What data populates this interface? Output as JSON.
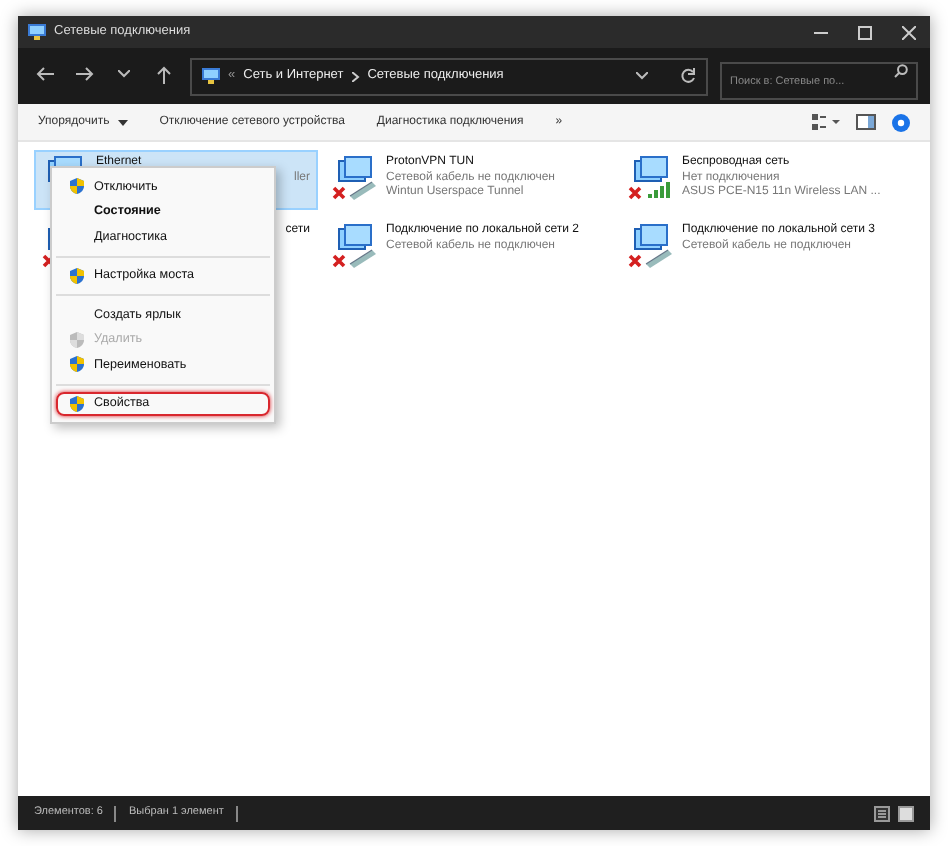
{
  "window": {
    "title": "Сетевые подключения"
  },
  "address": {
    "prefix": "«",
    "crumbs": [
      "Сеть и Интернет",
      "Сетевые подключения"
    ]
  },
  "search": {
    "placeholder": "Поиск в: Сетевые по..."
  },
  "toolbar": {
    "items": [
      {
        "label": "Упорядочить",
        "dropdown": true
      },
      {
        "label": "Отключение сетевого устройства",
        "dropdown": false
      },
      {
        "label": "Диагностика подключения",
        "dropdown": false
      },
      {
        "label": "»",
        "dropdown": false
      }
    ]
  },
  "connections": [
    {
      "name": "Ethernet",
      "device": "ller",
      "kind": "cable",
      "disconnected": false,
      "selected": true,
      "cut": true
    },
    {
      "name": "ProtonVPN TUN",
      "status": "Сетевой кабель не подключен",
      "device": "Wintun Userspace Tunnel",
      "kind": "cable",
      "disconnected": true,
      "selected": false,
      "cut": false
    },
    {
      "name": "Беспроводная сеть",
      "status": "Нет подключения",
      "device": "ASUS PCE-N15 11n Wireless LAN ...",
      "kind": "wireless",
      "disconnected": true,
      "selected": false,
      "cut": false
    },
    {
      "name": "сети",
      "kind": "cable",
      "disconnected": true,
      "selected": false,
      "cut": true
    },
    {
      "name": "Подключение по локальной сети 2",
      "status": "Сетевой кабель не подключен",
      "kind": "cable",
      "disconnected": true,
      "selected": false,
      "cut": false
    },
    {
      "name": "Подключение по локальной сети 3",
      "status": "Сетевой кабель не подключен",
      "kind": "cable",
      "disconnected": true,
      "selected": false,
      "cut": false
    }
  ],
  "context_menu": {
    "items": [
      {
        "kind": "item",
        "label": "Отключить",
        "shield": true,
        "bold": false,
        "disabled": false,
        "highlighted": false
      },
      {
        "kind": "item",
        "label": "Состояние",
        "shield": false,
        "bold": true,
        "disabled": false,
        "highlighted": false
      },
      {
        "kind": "item",
        "label": "Диагностика",
        "shield": false,
        "bold": false,
        "disabled": false,
        "highlighted": false
      },
      {
        "kind": "separator"
      },
      {
        "kind": "item",
        "label": "Настройка моста",
        "shield": true,
        "bold": false,
        "disabled": false,
        "highlighted": false
      },
      {
        "kind": "separator"
      },
      {
        "kind": "item",
        "label": "Создать ярлык",
        "shield": false,
        "bold": false,
        "disabled": false,
        "highlighted": false
      },
      {
        "kind": "item",
        "label": "Удалить",
        "shield": true,
        "bold": false,
        "disabled": true,
        "highlighted": false
      },
      {
        "kind": "item",
        "label": "Переименовать",
        "shield": true,
        "bold": false,
        "disabled": false,
        "highlighted": false
      },
      {
        "kind": "separator"
      },
      {
        "kind": "item",
        "label": "Свойства",
        "shield": true,
        "bold": false,
        "disabled": false,
        "highlighted": true
      }
    ]
  },
  "status_bar": {
    "items": [
      "Элементов: 6",
      "Выбран 1 элемент"
    ]
  }
}
